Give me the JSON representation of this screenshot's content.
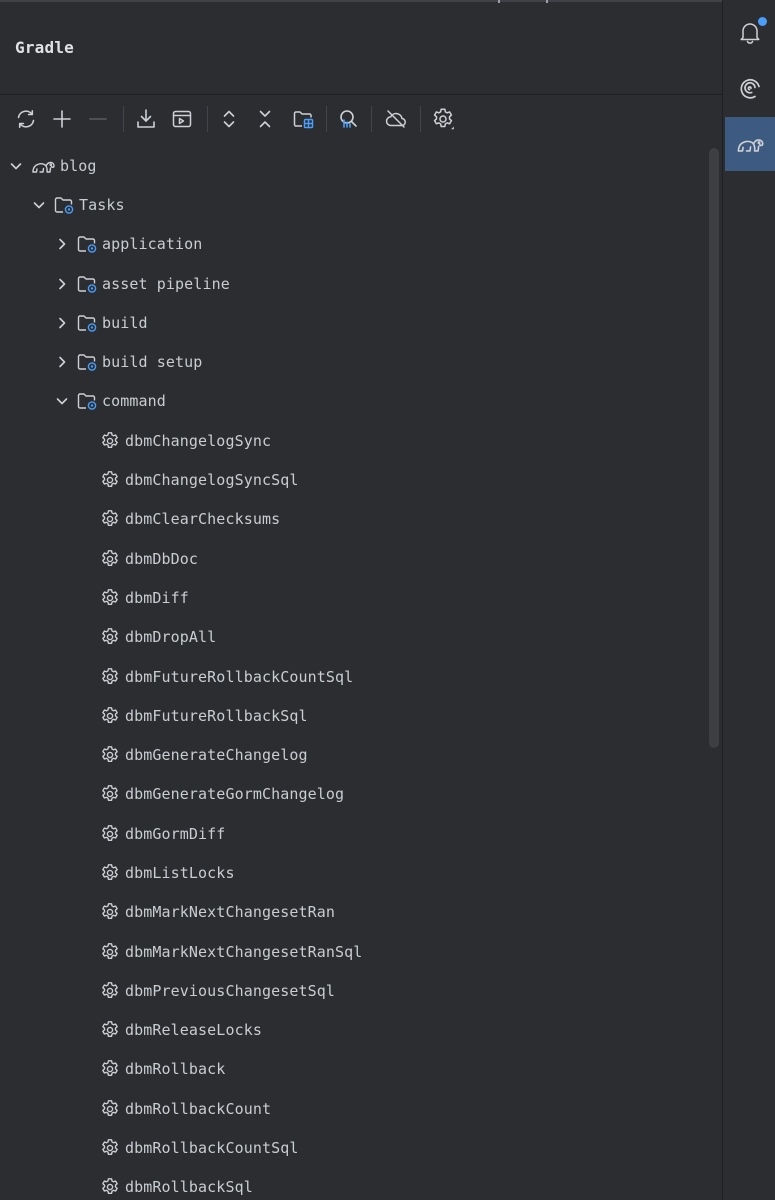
{
  "panel": {
    "title": "Gradle"
  },
  "toolbar": {
    "buttons": [
      {
        "name": "reload-all-icon"
      },
      {
        "name": "add-icon"
      },
      {
        "name": "remove-icon"
      },
      {
        "name": "download-sources-icon"
      },
      {
        "name": "run-task-icon"
      },
      {
        "name": "expand-all-icon"
      },
      {
        "name": "collapse-all-icon"
      },
      {
        "name": "group-modules-icon"
      },
      {
        "name": "analyze-dependencies-icon"
      },
      {
        "name": "offline-mode-icon"
      },
      {
        "name": "settings-icon"
      }
    ]
  },
  "tree": {
    "root": {
      "label": "blog",
      "expanded": true
    },
    "tasks": {
      "label": "Tasks",
      "expanded": true
    },
    "groups": [
      {
        "label": "application",
        "expanded": false
      },
      {
        "label": "asset pipeline",
        "expanded": false
      },
      {
        "label": "build",
        "expanded": false
      },
      {
        "label": "build setup",
        "expanded": false
      },
      {
        "label": "command",
        "expanded": true
      }
    ],
    "command_tasks": [
      "dbmChangelogSync",
      "dbmChangelogSyncSql",
      "dbmClearChecksums",
      "dbmDbDoc",
      "dbmDiff",
      "dbmDropAll",
      "dbmFutureRollbackCountSql",
      "dbmFutureRollbackSql",
      "dbmGenerateChangelog",
      "dbmGenerateGormChangelog",
      "dbmGormDiff",
      "dbmListLocks",
      "dbmMarkNextChangesetRan",
      "dbmMarkNextChangesetRanSql",
      "dbmPreviousChangesetSql",
      "dbmReleaseLocks",
      "dbmRollback",
      "dbmRollbackCount",
      "dbmRollbackCountSql",
      "dbmRollbackSql"
    ]
  },
  "sidebar": {
    "items": [
      {
        "name": "notifications-icon",
        "badge": true,
        "active": false
      },
      {
        "name": "ai-assistant-icon",
        "active": false
      },
      {
        "name": "gradle-elephant-icon",
        "active": true
      }
    ]
  },
  "colors": {
    "background": "#2b2d30",
    "text": "#c9ccd1",
    "icon": "#ced0d6",
    "accent_blue": "#4a9df8",
    "active_sidebar": "#3d5a80"
  }
}
